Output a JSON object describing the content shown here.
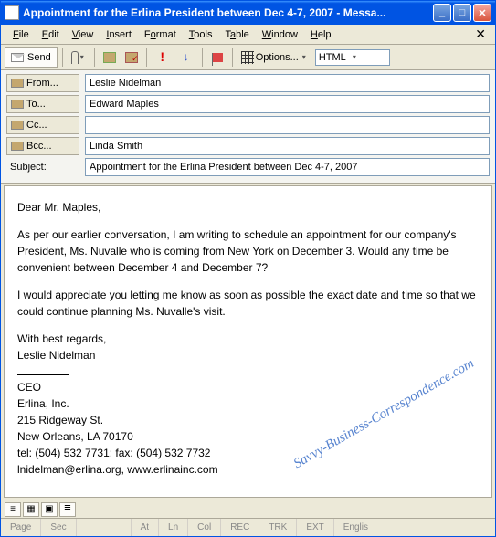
{
  "window": {
    "title": "Appointment for the Erlina President between Dec 4-7, 2007 - Messa..."
  },
  "menu": {
    "file": "File",
    "edit": "Edit",
    "view": "View",
    "insert": "Insert",
    "format": "Format",
    "tools": "Tools",
    "table": "Table",
    "window": "Window",
    "help": "Help"
  },
  "toolbar": {
    "send": "Send",
    "options": "Options...",
    "format_mode": "HTML"
  },
  "headers": {
    "from_label": "From...",
    "from_value": "Leslie Nidelman",
    "to_label": "To...",
    "to_value": "Edward Maples",
    "cc_label": "Cc...",
    "cc_value": "",
    "bcc_label": "Bcc...",
    "bcc_value": "Linda Smith",
    "subject_label": "Subject:",
    "subject_value": "Appointment for the Erlina President between Dec 4-7, 2007"
  },
  "body": {
    "greeting": "Dear Mr. Maples,",
    "p1": "As per our earlier conversation, I am writing to schedule an appointment for our company's President, Ms. Nuvalle who is coming from New York on December 3. Would any time be convenient between December 4 and December 7?",
    "p2": "I would appreciate you letting me know as soon as possible the exact date and time so that we could continue planning Ms. Nuvalle's visit.",
    "closing": "With best regards,",
    "sender": "Leslie Nidelman",
    "sig_title": "CEO",
    "sig_company": "Erlina, Inc.",
    "sig_street": "215 Ridgeway St.",
    "sig_city": "New Orleans, LA 70170",
    "sig_phone": "tel: (504) 532 7731; fax: (504) 532 7732",
    "sig_contact": "lnidelman@erlina.org, www.erlinainc.com"
  },
  "watermark": "Savvy-Business-Correspondence.com",
  "status": {
    "page": "Page",
    "sec": "Sec",
    "at": "At",
    "ln": "Ln",
    "col": "Col",
    "rec": "REC",
    "trk": "TRK",
    "ext": "EXT",
    "lang": "Englis"
  }
}
